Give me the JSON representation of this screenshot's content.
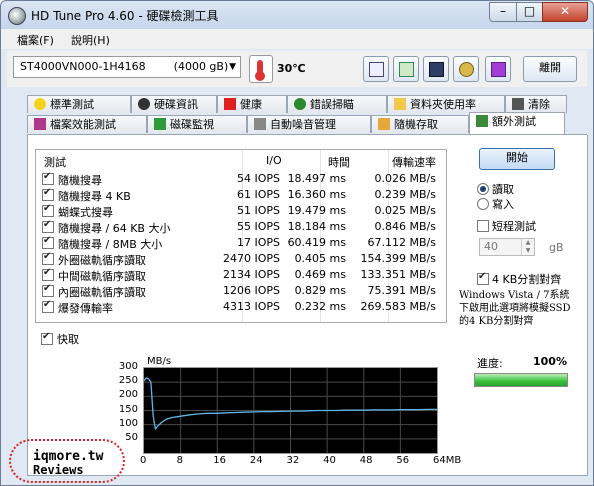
{
  "window": {
    "title": "HD Tune Pro 4.60 - 硬碟檢測工具"
  },
  "menu": {
    "file": "檔案(F)",
    "help": "說明(H)"
  },
  "toolbar": {
    "drive": "ST4000VN000-1H4168        (4000 gB)",
    "temperature": "30℃",
    "exit": "離開"
  },
  "tabs_row1": [
    "標準測試",
    "硬碟資訊",
    "健康",
    "錯誤掃瞄",
    "資料夾使用率",
    "清除"
  ],
  "tabs_row2": [
    "檔案效能測試",
    "磁碟監視",
    "自動噪音管理",
    "隨機存取",
    "額外測試"
  ],
  "table": {
    "headers": {
      "test": "測試",
      "io": "I/O",
      "time": "時間",
      "rate": "傳輸速率"
    },
    "rows": [
      {
        "name": "隨機搜尋",
        "io": "54 IOPS",
        "time": "18.497 ms",
        "rate": "0.026 MB/s"
      },
      {
        "name": "隨機搜尋 4 KB",
        "io": "61 IOPS",
        "time": "16.360 ms",
        "rate": "0.239 MB/s"
      },
      {
        "name": "蝴蝶式搜尋",
        "io": "51 IOPS",
        "time": "19.479 ms",
        "rate": "0.025 MB/s"
      },
      {
        "name": "隨機搜尋 / 64 KB 大小",
        "io": "55 IOPS",
        "time": "18.184 ms",
        "rate": "0.846 MB/s"
      },
      {
        "name": "隨機搜尋 / 8MB 大小",
        "io": "17 IOPS",
        "time": "60.419 ms",
        "rate": "67.112 MB/s"
      },
      {
        "name": "外圈磁軌循序讀取",
        "io": "2470 IOPS",
        "time": "0.405 ms",
        "rate": "154.399 MB/s"
      },
      {
        "name": "中間磁軌循序讀取",
        "io": "2134 IOPS",
        "time": "0.469 ms",
        "rate": "133.351 MB/s"
      },
      {
        "name": "內圈磁軌循序讀取",
        "io": "1206 IOPS",
        "time": "0.829 ms",
        "rate": "75.391 MB/s"
      },
      {
        "name": "爆發傳輸率",
        "io": "4313 IOPS",
        "time": "0.232 ms",
        "rate": "269.583 MB/s"
      }
    ]
  },
  "side": {
    "start": "開始",
    "read": "讀取",
    "write": "寫入",
    "short_test": "短程測試",
    "size_value": "40",
    "size_unit": "gB",
    "align4k": "4 KB分割對齊",
    "note": "Windows Vista / 7系統下啟用此選項將模擬SSD的4 KB分割對齊"
  },
  "quick": "快取",
  "progress": {
    "label": "進度:",
    "value": "100%",
    "fraction": 1.0
  },
  "chart_data": {
    "type": "line",
    "ylabel": "MB/s",
    "xlabel_suffix": "64MB",
    "x_ticks": [
      "0",
      "8",
      "16",
      "24",
      "32",
      "40",
      "48",
      "56",
      "64MB"
    ],
    "y_ticks": [
      "300",
      "250",
      "200",
      "150",
      "100",
      "50"
    ],
    "xlim": [
      0,
      64
    ],
    "ylim": [
      0,
      300
    ],
    "series": [
      {
        "x": [
          0,
          0.5,
          1,
          1.5,
          2,
          2.5,
          3,
          4,
          5,
          6,
          8,
          10,
          12,
          14,
          16,
          18,
          20,
          22,
          24,
          26,
          28,
          30,
          32,
          34,
          36,
          38,
          40,
          42,
          44,
          46,
          48,
          50,
          52,
          54,
          56,
          58,
          60,
          62,
          64
        ],
        "y": [
          255,
          265,
          262,
          250,
          130,
          85,
          95,
          110,
          120,
          125,
          130,
          135,
          138,
          140,
          140,
          142,
          143,
          144,
          145,
          146,
          146,
          147,
          148,
          148,
          149,
          150,
          150,
          150,
          151,
          151,
          151,
          152,
          152,
          152,
          153,
          153,
          153,
          154,
          154
        ]
      }
    ],
    "grid": true,
    "line_color": "#5fb6e8",
    "grid_color": "#4a4a4a"
  },
  "watermark": {
    "line1": "iqmore.tw",
    "line2": "Reviews"
  }
}
